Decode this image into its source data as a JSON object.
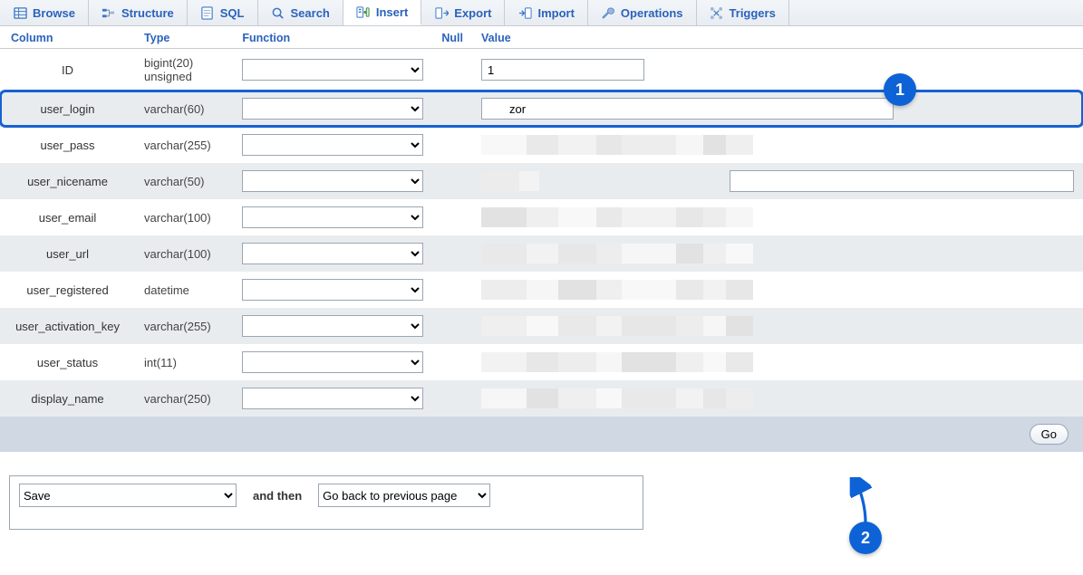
{
  "tabs": [
    {
      "id": "browse",
      "label": "Browse",
      "icon": "table-icon"
    },
    {
      "id": "structure",
      "label": "Structure",
      "icon": "structure-icon"
    },
    {
      "id": "sql",
      "label": "SQL",
      "icon": "sql-icon"
    },
    {
      "id": "search",
      "label": "Search",
      "icon": "search-icon"
    },
    {
      "id": "insert",
      "label": "Insert",
      "icon": "insert-icon",
      "active": true
    },
    {
      "id": "export",
      "label": "Export",
      "icon": "export-icon"
    },
    {
      "id": "import",
      "label": "Import",
      "icon": "import-icon"
    },
    {
      "id": "operations",
      "label": "Operations",
      "icon": "wrench-icon"
    },
    {
      "id": "triggers",
      "label": "Triggers",
      "icon": "triggers-icon"
    }
  ],
  "headers": {
    "column": "Column",
    "type": "Type",
    "function": "Function",
    "null": "Null",
    "value": "Value"
  },
  "rows": [
    {
      "name": "ID",
      "type": "bigint(20) unsigned",
      "value": "1",
      "val_width": "short"
    },
    {
      "name": "user_login",
      "type": "varchar(60)",
      "value": "zor",
      "val_width": "long",
      "highlight": true
    },
    {
      "name": "user_pass",
      "type": "varchar(255)",
      "obscured": true
    },
    {
      "name": "user_nicename",
      "type": "varchar(50)",
      "value": "",
      "val_width": "med",
      "obscured_prefix": true
    },
    {
      "name": "user_email",
      "type": "varchar(100)",
      "obscured": true
    },
    {
      "name": "user_url",
      "type": "varchar(100)",
      "obscured": true
    },
    {
      "name": "user_registered",
      "type": "datetime",
      "obscured": true
    },
    {
      "name": "user_activation_key",
      "type": "varchar(255)",
      "obscured": true
    },
    {
      "name": "user_status",
      "type": "int(11)",
      "obscured": true
    },
    {
      "name": "display_name",
      "type": "varchar(250)",
      "obscured": true
    }
  ],
  "go_button": "Go",
  "save_panel": {
    "action_select": "Save",
    "and_then": "and then",
    "after_select": "Go back to previous page"
  },
  "annotations": {
    "badge1": "1",
    "badge2": "2"
  }
}
